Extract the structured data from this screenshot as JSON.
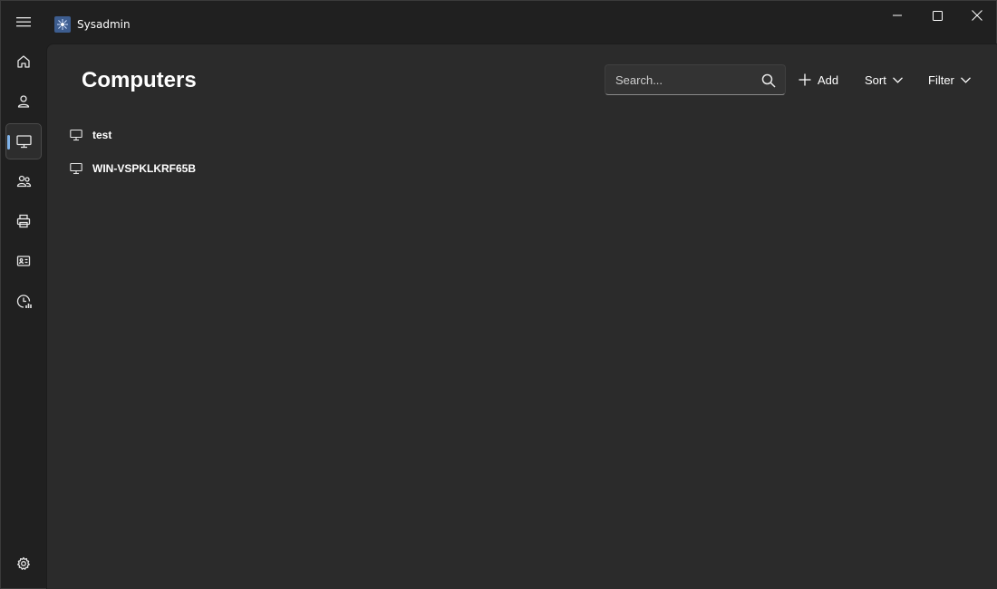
{
  "app": {
    "title": "Sysadmin",
    "icon": "network-hub-icon",
    "accent_color": "#7fb2e8"
  },
  "window_controls": [
    "minimize-icon",
    "maximize-icon",
    "close-icon"
  ],
  "nav": {
    "menu_icon": "hamburger-menu-icon",
    "items": [
      {
        "id": "home",
        "icon": "home-icon",
        "selected": false
      },
      {
        "id": "users",
        "icon": "user-icon",
        "selected": false
      },
      {
        "id": "computers",
        "icon": "monitor-icon",
        "selected": true
      },
      {
        "id": "groups",
        "icon": "people-icon",
        "selected": false
      },
      {
        "id": "printers",
        "icon": "printer-icon",
        "selected": false
      },
      {
        "id": "contacts",
        "icon": "contact-card-icon",
        "selected": false
      },
      {
        "id": "reports",
        "icon": "chart-clock-icon",
        "selected": false
      }
    ],
    "settings_icon": "gear-icon"
  },
  "page": {
    "title": "Computers"
  },
  "toolbar": {
    "search": {
      "placeholder": "Search...",
      "value": ""
    },
    "add_label": "Add",
    "sort_label": "Sort",
    "filter_label": "Filter"
  },
  "computers": [
    {
      "name": "test"
    },
    {
      "name": "WIN-VSPKLKRF65B"
    }
  ]
}
